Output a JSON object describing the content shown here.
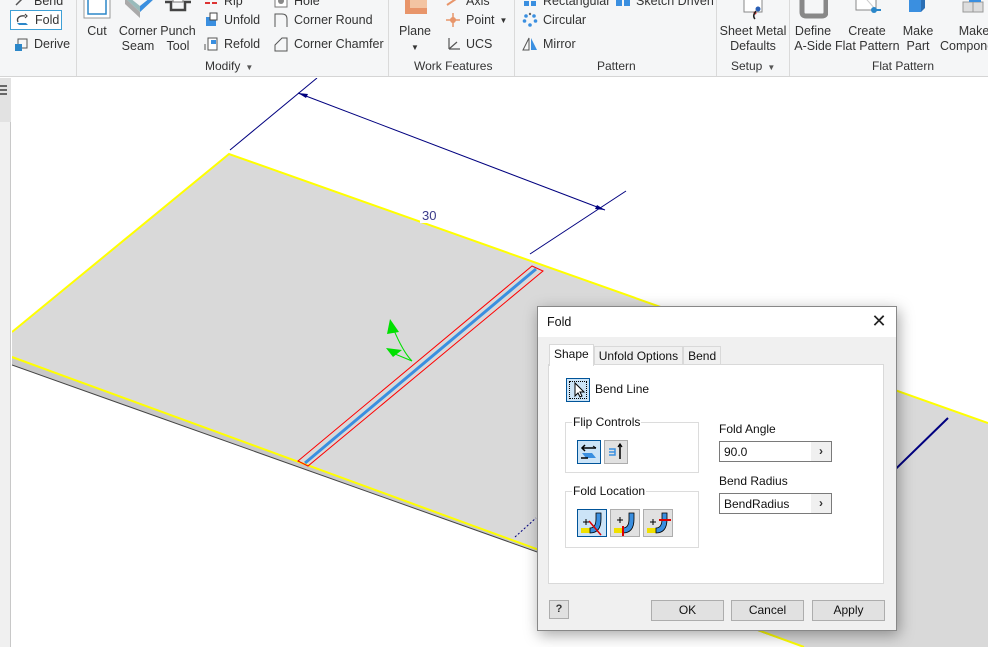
{
  "ribbon": {
    "sheet_metal_left": {
      "items": [
        {
          "label": "Bend",
          "icon": "bend-icon"
        },
        {
          "label": "Fold",
          "icon": "fold-icon",
          "active": true
        },
        {
          "label": "Derive",
          "icon": "derive-icon"
        }
      ]
    },
    "modify": {
      "title": "Modify",
      "big_buttons": [
        {
          "label": "Cut",
          "icon": "cut-icon"
        },
        {
          "label_line1": "Corner",
          "label_line2": "Seam",
          "icon": "corner-seam-icon"
        },
        {
          "label_line1": "Punch",
          "label_line2": "Tool",
          "icon": "punch-tool-icon"
        }
      ],
      "small_col1": [
        {
          "label": "Rip",
          "icon": "rip-icon"
        },
        {
          "label": "Unfold",
          "icon": "unfold-icon"
        },
        {
          "label": "Refold",
          "icon": "refold-icon"
        }
      ],
      "small_col2": [
        {
          "label": "Hole",
          "icon": "hole-icon"
        },
        {
          "label": "Corner Round",
          "icon": "corner-round-icon"
        },
        {
          "label": "Corner Chamfer",
          "icon": "corner-chamfer-icon"
        }
      ]
    },
    "work_features": {
      "title": "Work Features",
      "plane_label": "Plane",
      "small": [
        {
          "label": "Axis",
          "icon": "axis-icon"
        },
        {
          "label": "Point",
          "icon": "point-icon"
        },
        {
          "label": "UCS",
          "icon": "ucs-icon"
        }
      ]
    },
    "pattern": {
      "title": "Pattern",
      "small": [
        {
          "label": "Rectangular",
          "icon": "rectangular-pattern-icon"
        },
        {
          "label": "Circular",
          "icon": "circular-pattern-icon"
        },
        {
          "label": "Mirror",
          "icon": "mirror-icon"
        }
      ],
      "extra": {
        "label": "Sketch Driven",
        "icon": "sketch-driven-icon"
      }
    },
    "setup": {
      "title": "Setup",
      "button_line1": "Sheet Metal",
      "button_line2": "Defaults"
    },
    "flat_pattern": {
      "title": "Flat Pattern",
      "buttons": [
        {
          "label_line1": "Define",
          "label_line2": "A-Side",
          "icon": "define-a-side-icon"
        },
        {
          "label_line1": "Create",
          "label_line2": "Flat Pattern",
          "icon": "create-flat-pattern-icon"
        },
        {
          "label_line1": "Make",
          "label_line2": "Part",
          "icon": "make-part-icon"
        },
        {
          "label_line1": "Make",
          "label_line2": "Components",
          "icon": "make-components-icon"
        }
      ]
    }
  },
  "viewport": {
    "dimension_value": "30",
    "colors": {
      "sheet_face": "#d9d9d9",
      "edge_highlight": "#ffff00",
      "bend_line": "#3a8fe0",
      "bend_zone": "#ff0000",
      "dimension": "#00007f",
      "direction_arrow": "#00e000"
    }
  },
  "dialog": {
    "title": "Fold",
    "tabs": [
      {
        "label": "Shape",
        "active": true
      },
      {
        "label": "Unfold Options",
        "active": false
      },
      {
        "label": "Bend",
        "active": false
      }
    ],
    "bend_line_label": "Bend Line",
    "flip_controls": {
      "legend": "Flip Controls",
      "buttons": [
        {
          "name": "flip-side",
          "pressed": true
        },
        {
          "name": "flip-direction",
          "pressed": false
        }
      ]
    },
    "fold_location": {
      "legend": "Fold Location",
      "buttons": [
        {
          "name": "centerline-of-bend",
          "pressed": true
        },
        {
          "name": "start-of-bend",
          "pressed": false
        },
        {
          "name": "end-of-bend",
          "pressed": false
        }
      ]
    },
    "fold_angle": {
      "label": "Fold Angle",
      "value": "90.0"
    },
    "bend_radius": {
      "label": "Bend Radius",
      "value": "BendRadius"
    },
    "buttons": {
      "help": "?",
      "ok": "OK",
      "cancel": "Cancel",
      "apply": "Apply"
    }
  }
}
